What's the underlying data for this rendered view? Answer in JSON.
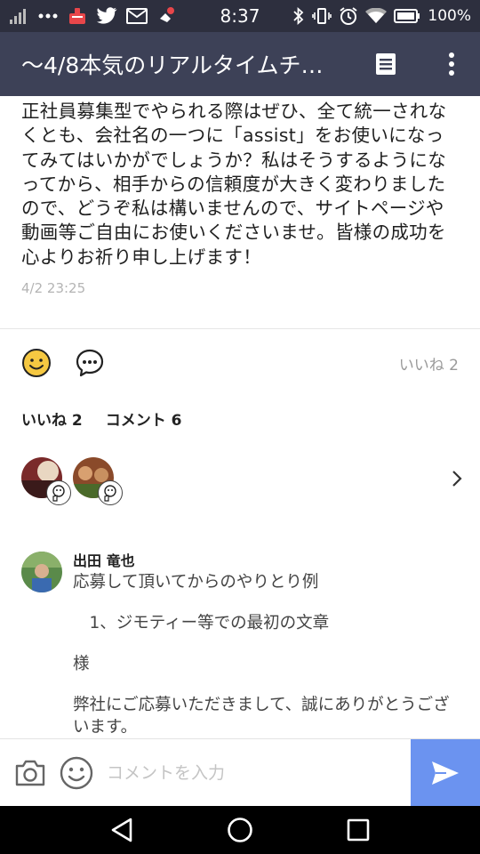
{
  "status_bar": {
    "time": "8:37",
    "battery": "100%",
    "left_icons": [
      "signal-icon",
      "more-dots-icon",
      "app-notification-icon",
      "twitter-icon",
      "mail-icon",
      "notification-icon"
    ],
    "right_icons": [
      "bluetooth-icon",
      "vibrate-icon",
      "alarm-icon",
      "wifi-icon",
      "battery-icon"
    ]
  },
  "app_bar": {
    "title": "〜4/8本気のリアルタイムチ…",
    "actions": [
      "note-icon",
      "more-vertical-icon"
    ]
  },
  "post": {
    "body": "正社員募集型でやられる際はぜひ、全て統一されなくとも、会社名の一つに「assist」をお使いになってみてはいかがでしょうか？私はそうするようになってから、相手からの信頼度が大きく変わりましたので、どうぞ私は構いませんので、サイトページや動画等ご自由にお使いくださいませ。皆様の成功を心よりお祈り申し上げます！",
    "time": "4/2 23:25"
  },
  "reactions": {
    "like_summary": "いいね 2"
  },
  "counts": {
    "likes": "いいね 2",
    "comments": "コメント 6"
  },
  "comment": {
    "author": "出田 竜也",
    "lines": [
      "応募して頂いてからのやりとり例",
      "",
      "　1、ジモティー等での最初の文章",
      "",
      "様",
      "",
      "弊社にご応募いただきまして、誠にありがとうございます。"
    ]
  },
  "input_bar": {
    "placeholder": "コメントを入力"
  },
  "colors": {
    "status_bar": "#2d2f3e",
    "app_bar": "#3d4157",
    "send_button": "#6b93f0",
    "smiley_yellow": "#f5c842"
  }
}
